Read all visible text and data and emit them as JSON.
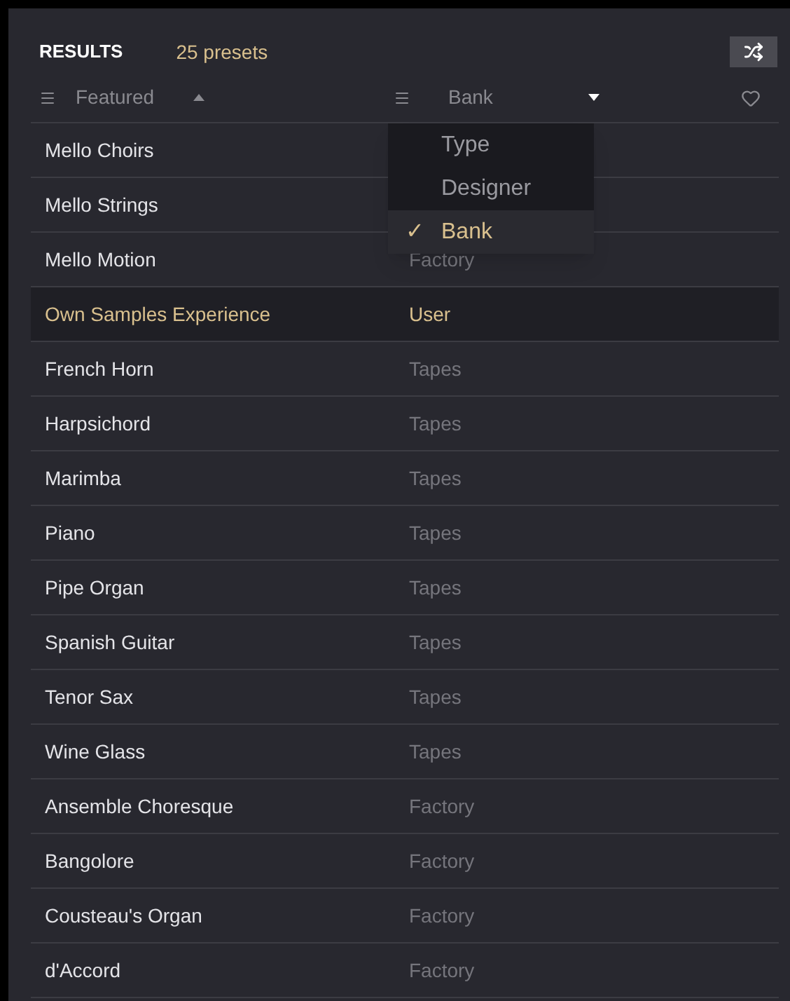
{
  "header": {
    "title": "RESULTS",
    "count": "25 presets"
  },
  "columns": [
    {
      "label": "Featured",
      "ascending": true
    },
    {
      "label": "Bank",
      "ascending": false
    }
  ],
  "dropdown": [
    {
      "label": "Type",
      "selected": false
    },
    {
      "label": "Designer",
      "selected": false
    },
    {
      "label": "Bank",
      "selected": true,
      "check": "✓"
    }
  ],
  "rows": [
    {
      "name": "Mello Choirs",
      "selected": false
    },
    {
      "name": "Mello Strings",
      "selected": false
    },
    {
      "name": "Mello Motion",
      "bank": "Factory",
      "selected": false
    },
    {
      "name": "Own Samples Experience",
      "bank": "User",
      "selected": true
    },
    {
      "name": "French Horn",
      "bank": "Tapes",
      "selected": false
    },
    {
      "name": "Harpsichord",
      "bank": "Tapes",
      "selected": false
    },
    {
      "name": "Marimba",
      "bank": "Tapes",
      "selected": false
    },
    {
      "name": "Piano",
      "bank": "Tapes",
      "selected": false
    },
    {
      "name": "Pipe Organ",
      "bank": "Tapes",
      "selected": false
    },
    {
      "name": "Spanish Guitar",
      "bank": "Tapes",
      "selected": false
    },
    {
      "name": "Tenor Sax",
      "bank": "Tapes",
      "selected": false
    },
    {
      "name": "Wine Glass",
      "bank": "Tapes",
      "selected": false
    },
    {
      "name": "Ansemble Choresque",
      "bank": "Factory",
      "selected": false
    },
    {
      "name": "Bangolore",
      "bank": "Factory",
      "selected": false
    },
    {
      "name": "Cousteau's Organ",
      "bank": "Factory",
      "selected": false
    },
    {
      "name": "d'Accord",
      "bank": "Factory",
      "selected": false
    }
  ]
}
